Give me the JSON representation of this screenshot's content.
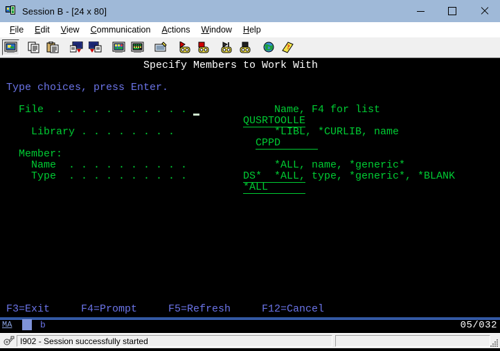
{
  "window": {
    "title": "Session B - [24 x 80]",
    "icon": "session-window-icon",
    "minimize_label": "Minimize",
    "maximize_label": "Maximize",
    "close_label": "Close"
  },
  "menu": {
    "items": [
      {
        "label": "File",
        "accel": "F"
      },
      {
        "label": "Edit",
        "accel": "E"
      },
      {
        "label": "View",
        "accel": "V"
      },
      {
        "label": "Communication",
        "accel": "C"
      },
      {
        "label": "Actions",
        "accel": "A"
      },
      {
        "label": "Window",
        "accel": "W"
      },
      {
        "label": "Help",
        "accel": "H"
      }
    ]
  },
  "toolbar": {
    "buttons": [
      {
        "name": "display-session-icon",
        "tooltip": "Display Session"
      },
      {
        "name": "copy-icon",
        "tooltip": "Copy"
      },
      {
        "name": "paste-icon",
        "tooltip": "Paste"
      },
      {
        "name": "send-file-icon",
        "tooltip": "Send File to Host"
      },
      {
        "name": "receive-file-icon",
        "tooltip": "Receive File from Host"
      },
      {
        "name": "keypad-icon",
        "tooltip": "Display Keypad"
      },
      {
        "name": "display-matrix-icon",
        "tooltip": "Display Matrix"
      },
      {
        "name": "keyboard-remap-icon",
        "tooltip": "Remap Keyboard"
      },
      {
        "name": "record-macro-icon",
        "tooltip": "Record Macro"
      },
      {
        "name": "stop-record-icon",
        "tooltip": "Stop Recording"
      },
      {
        "name": "play-macro-icon",
        "tooltip": "Play Macro"
      },
      {
        "name": "stop-macro-icon",
        "tooltip": "Stop Macro"
      },
      {
        "name": "internet-icon",
        "tooltip": "Internet Home Page"
      },
      {
        "name": "help-icon",
        "tooltip": "Help"
      }
    ]
  },
  "terminal": {
    "screen_title": "Specify Members to Work With",
    "instruction": "Type choices, press Enter.",
    "fields": [
      {
        "label": "File  . . . . . . . . . . .",
        "value": "QUSRTOOLLE",
        "field_width": 10,
        "hint": "Name, F4 for list"
      },
      {
        "label": "Library . . . . . . . .",
        "value": "CPPD",
        "field_width": 10,
        "hint": "*LIBL, *CURLIB, name"
      }
    ],
    "member_group_label": "Member:",
    "member_fields": [
      {
        "label": "Name  . . . . . . . . . .",
        "value": "DS*",
        "field_width": 10,
        "hint": "*ALL, name, *generic*"
      },
      {
        "label": "Type  . . . . . . . . . .",
        "value": "*ALL",
        "field_width": 10,
        "hint": "*ALL, type, *generic*, *BLANK"
      }
    ],
    "function_keys": [
      "F3=Exit",
      "F4=Prompt",
      "F5=Refresh",
      "F12=Cancel"
    ],
    "oia": {
      "system_indicator": "MA",
      "input_indicator": "b",
      "cursor_position": "05/032"
    },
    "colors": {
      "background": "#000000",
      "title_text": "#ffffff",
      "label_text": "#00cc33",
      "instruction_text": "#6b74e8",
      "function_key_text": "#6b74e8"
    }
  },
  "status_bar": {
    "connection_icon": "connection-icon",
    "message": "I902 - Session successfully started",
    "second_panel": ""
  }
}
